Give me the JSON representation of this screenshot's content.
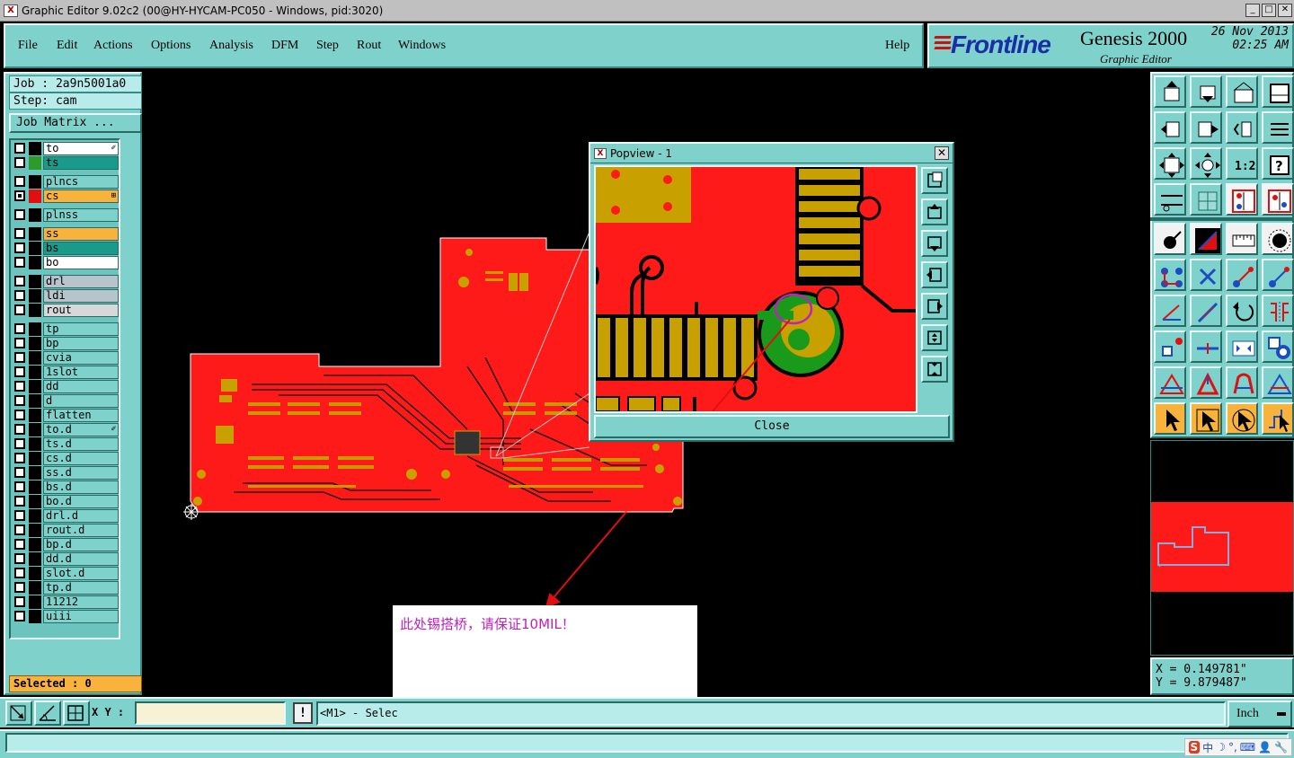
{
  "window": {
    "title": "Graphic Editor 9.02c2 (00@HY-HYCAM-PC050 - Windows, pid:3020)",
    "buttons": [
      "_",
      "□",
      "✕"
    ]
  },
  "menu": {
    "items": [
      "File",
      "Edit",
      "Actions",
      "Options",
      "Analysis",
      "DFM",
      "Step",
      "Rout",
      "Windows"
    ],
    "help": "Help"
  },
  "brand": {
    "logo": "Frontline",
    "product": "Genesis 2000",
    "subtitle": "Graphic Editor",
    "date": "26 Nov 2013",
    "time": "02:25 AM"
  },
  "left": {
    "job": "Job : 2a9n5001a0",
    "step": "Step: cam",
    "job_matrix": "Job Matrix ...",
    "selected": "Selected : 0",
    "layers": [
      {
        "name": "to",
        "swatch": "#000000",
        "bg": "#ffffff",
        "mark": "✐"
      },
      {
        "name": "ts",
        "swatch": "#2e9a2e",
        "bg": "#1a9a8a"
      },
      {
        "name": "plncs",
        "swatch": "#000000",
        "bg": "#7fd2cc"
      },
      {
        "name": "cs",
        "swatch": "#e01010",
        "bg": "#f7b33c",
        "active": true,
        "mark": "⊞"
      },
      {
        "name": "plnss",
        "swatch": "#000000",
        "bg": "#7fd2cc"
      },
      {
        "name": "ss",
        "swatch": "#000000",
        "bg": "#f7b33c"
      },
      {
        "name": "bs",
        "swatch": "#000000",
        "bg": "#1a9a8a"
      },
      {
        "name": "bo",
        "swatch": "#000000",
        "bg": "#ffffff"
      },
      {
        "name": "drl",
        "swatch": "#000000",
        "bg": "#b8c4cc"
      },
      {
        "name": "ldi",
        "swatch": "#000000",
        "bg": "#b8c4cc"
      },
      {
        "name": "rout",
        "swatch": "#000000",
        "bg": "#d8d8d8"
      },
      {
        "name": "tp",
        "swatch": "#000000",
        "bg": "#7fd2cc"
      },
      {
        "name": "bp",
        "swatch": "#000000",
        "bg": "#7fd2cc"
      },
      {
        "name": "cvia",
        "swatch": "#000000",
        "bg": "#7fd2cc"
      },
      {
        "name": "1slot",
        "swatch": "#000000",
        "bg": "#7fd2cc"
      },
      {
        "name": "dd",
        "swatch": "#000000",
        "bg": "#7fd2cc"
      },
      {
        "name": "d",
        "swatch": "#000000",
        "bg": "#7fd2cc"
      },
      {
        "name": "flatten",
        "swatch": "#000000",
        "bg": "#7fd2cc"
      },
      {
        "name": "to.d",
        "swatch": "#000000",
        "bg": "#7fd2cc",
        "mark": "✐"
      },
      {
        "name": "ts.d",
        "swatch": "#000000",
        "bg": "#7fd2cc"
      },
      {
        "name": "cs.d",
        "swatch": "#000000",
        "bg": "#7fd2cc"
      },
      {
        "name": "ss.d",
        "swatch": "#000000",
        "bg": "#7fd2cc"
      },
      {
        "name": "bs.d",
        "swatch": "#000000",
        "bg": "#7fd2cc"
      },
      {
        "name": "bo.d",
        "swatch": "#000000",
        "bg": "#7fd2cc"
      },
      {
        "name": "drl.d",
        "swatch": "#000000",
        "bg": "#7fd2cc"
      },
      {
        "name": "rout.d",
        "swatch": "#000000",
        "bg": "#7fd2cc"
      },
      {
        "name": "bp.d",
        "swatch": "#000000",
        "bg": "#7fd2cc"
      },
      {
        "name": "dd.d",
        "swatch": "#000000",
        "bg": "#7fd2cc"
      },
      {
        "name": "slot.d",
        "swatch": "#000000",
        "bg": "#7fd2cc"
      },
      {
        "name": "tp.d",
        "swatch": "#000000",
        "bg": "#7fd2cc"
      },
      {
        "name": "11212",
        "swatch": "#000000",
        "bg": "#7fd2cc"
      },
      {
        "name": "uiii",
        "swatch": "#000000",
        "bg": "#7fd2cc"
      }
    ]
  },
  "popview": {
    "title": "Popview - 1",
    "close_label": "Close",
    "tools": [
      "zoom-home-icon",
      "pan-up-icon",
      "pan-down-icon",
      "pan-left-icon",
      "pan-right-icon",
      "zoom-in-icon",
      "zoom-out-icon"
    ]
  },
  "note": {
    "text": "此处锡搭桥，请保证10MIL！"
  },
  "right": {
    "coords_x": "X = 0.149781\"",
    "coords_y": "Y = 9.879487\""
  },
  "bottom": {
    "xy_label": "X Y :",
    "xy_value": "",
    "exclaim": "!",
    "status": "<M1> - Selec",
    "unit": "Inch"
  },
  "ime": {
    "logo": "S",
    "items": [
      "中",
      "☽",
      "°,",
      "⌨",
      "👤",
      "🔧"
    ]
  },
  "colors": {
    "panel": "#7fd2cc",
    "copper": "#ff1a1a",
    "pad": "#c8a000",
    "mask": "#1a9a1a",
    "annotation": "#c020c0"
  }
}
